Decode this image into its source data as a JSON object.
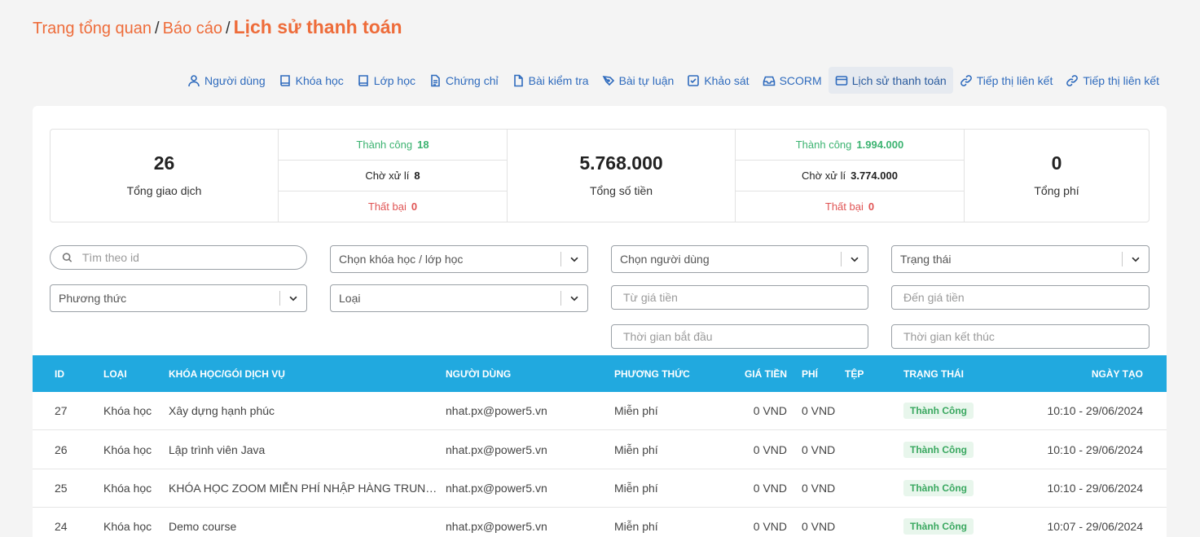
{
  "breadcrumb": {
    "items": [
      "Trang tổng quan",
      "Báo cáo"
    ],
    "current": "Lịch sử thanh toán",
    "separator": "/"
  },
  "tabs": [
    {
      "label": "Người dùng",
      "icon": "user-icon"
    },
    {
      "label": "Khóa học",
      "icon": "book-icon"
    },
    {
      "label": "Lớp học",
      "icon": "book-icon"
    },
    {
      "label": "Chứng chỉ",
      "icon": "document-icon"
    },
    {
      "label": "Bài kiểm tra",
      "icon": "file-icon"
    },
    {
      "label": "Bài tự luận",
      "icon": "pen-icon"
    },
    {
      "label": "Khảo sát",
      "icon": "checkbox-icon"
    },
    {
      "label": "SCORM",
      "icon": "inbox-icon"
    },
    {
      "label": "Lịch sử thanh toán",
      "icon": "credit-card-icon",
      "active": true
    },
    {
      "label": "Tiếp thị liên kết",
      "icon": "link-icon"
    },
    {
      "label": "Tiếp thị liên kết",
      "icon": "link-icon"
    }
  ],
  "stats": {
    "total_transactions": {
      "value": "26",
      "label": "Tổng giao dịch"
    },
    "tx_breakdown": {
      "success_label": "Thành công",
      "success_value": "18",
      "pending_label": "Chờ xử lí",
      "pending_value": "8",
      "failed_label": "Thất bại",
      "failed_value": "0"
    },
    "total_amount": {
      "value": "5.768.000",
      "label": "Tổng số tiền"
    },
    "amount_breakdown": {
      "success_label": "Thành công",
      "success_value": "1.994.000",
      "pending_label": "Chờ xử lí",
      "pending_value": "3.774.000",
      "failed_label": "Thất bại",
      "failed_value": "0"
    },
    "total_fee": {
      "value": "0",
      "label": "Tổng phí"
    }
  },
  "filters": {
    "search_placeholder": "Tìm theo id",
    "course_select": "Chọn khóa học / lớp học",
    "user_select": "Chọn người dùng",
    "status_select": "Trạng thái",
    "method_select": "Phương thức",
    "type_select": "Loại",
    "price_from_placeholder": "Từ giá tiền",
    "price_to_placeholder": "Đến giá tiền",
    "start_time_placeholder": "Thời gian bắt đầu",
    "end_time_placeholder": "Thời gian kết thúc"
  },
  "table": {
    "headers": {
      "id": "ID",
      "type": "LOẠI",
      "course": "KHÓA HỌC/GÓI DỊCH VỤ",
      "user": "NGƯỜI DÙNG",
      "method": "PHƯƠNG THỨC",
      "price": "GIÁ TIỀN",
      "fee": "PHÍ",
      "file": "TỆP",
      "status": "TRẠNG THÁI",
      "date": "NGÀY TẠO"
    },
    "rows": [
      {
        "id": "27",
        "type": "Khóa học",
        "course": "Xây dựng hạnh phúc",
        "user": "nhat.px@power5.vn",
        "method": "Miễn phí",
        "price": "0 VND",
        "fee": "0 VND",
        "status": "Thành Công",
        "date": "10:10 - 29/06/2024"
      },
      {
        "id": "26",
        "type": "Khóa học",
        "course": "Lập trình viên Java",
        "user": "nhat.px@power5.vn",
        "method": "Miễn phí",
        "price": "0 VND",
        "fee": "0 VND",
        "status": "Thành Công",
        "date": "10:10 - 29/06/2024"
      },
      {
        "id": "25",
        "type": "Khóa học",
        "course": "KHÓA HỌC ZOOM MIỄN PHÍ NHẬP HÀNG TRUNG QUỐC",
        "user": "nhat.px@power5.vn",
        "method": "Miễn phí",
        "price": "0 VND",
        "fee": "0 VND",
        "status": "Thành Công",
        "date": "10:10 - 29/06/2024"
      },
      {
        "id": "24",
        "type": "Khóa học",
        "course": "Demo course",
        "user": "nhat.px@power5.vn",
        "method": "Miễn phí",
        "price": "0 VND",
        "fee": "0 VND",
        "status": "Thành Công",
        "date": "10:07 - 29/06/2024"
      }
    ]
  },
  "colors": {
    "accent": "#ee6c3a",
    "link": "#2f6bbd",
    "table_header": "#21a9df",
    "success": "#3cb371",
    "failed": "#e05555"
  }
}
